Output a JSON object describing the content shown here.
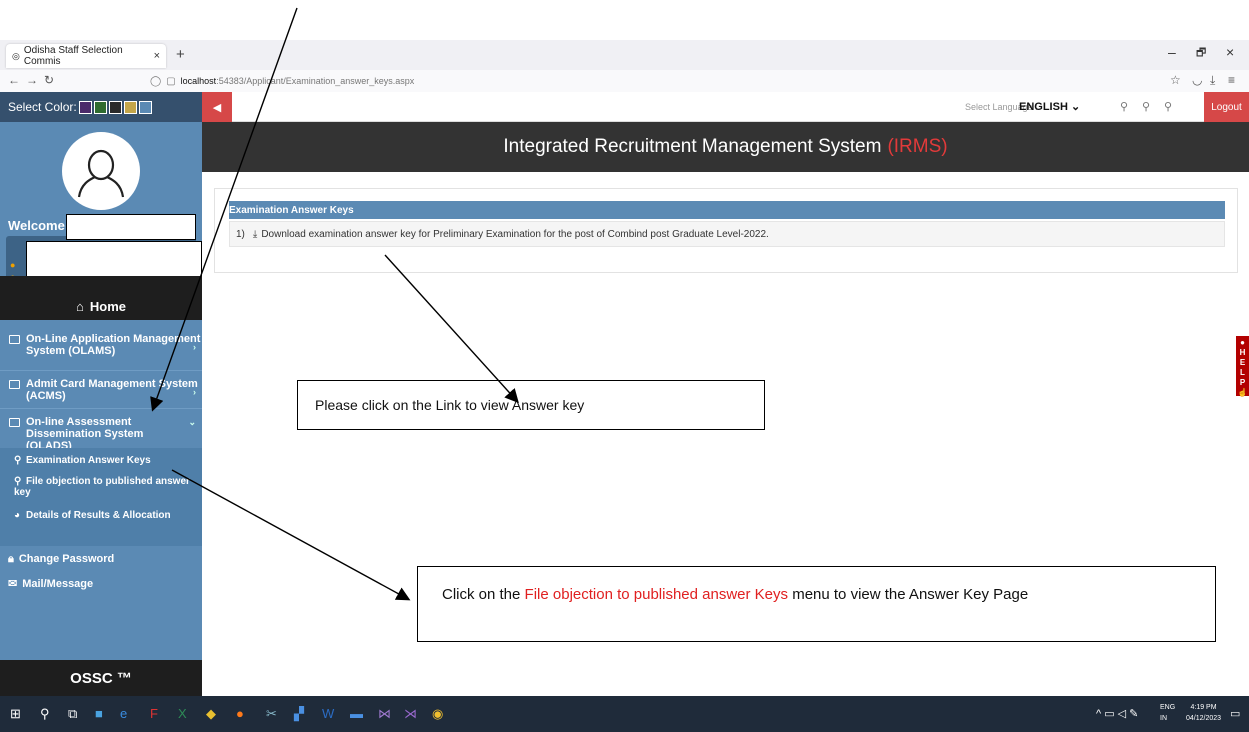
{
  "browser": {
    "tab_title": "Odisha Staff Selection Commis",
    "tab_close": "×",
    "new_tab": "+",
    "window_minimize": "–",
    "window_maximize": "🗗",
    "window_close": "×",
    "url_host": "localhost",
    "url_rest": ":54383/Applicant/Examination_answer_keys.aspx"
  },
  "sidebar": {
    "select_color_label": "Select Color:",
    "swatches": [
      "#4a2a6a",
      "#2f6b2f",
      "#2a2a2a",
      "#c4a64a",
      "#5b8ab4"
    ],
    "welcome": "Welcome",
    "home": "Home",
    "menu": [
      {
        "label": "On-Line Application Management System (OLAMS)"
      },
      {
        "label": "Admit Card Management System (ACMS)"
      },
      {
        "label": "On-line Assessment Dissemination System (OLADS)"
      }
    ],
    "submenu": [
      {
        "label": "Examination Answer Keys"
      },
      {
        "label": "File objection to published answer key"
      },
      {
        "label": "Details of Results & Allocation"
      }
    ],
    "change_password": "Change Password",
    "mail_message": "Mail/Message",
    "footer": "OSSC ™"
  },
  "toolbar": {
    "select_language_label": "Select Language :",
    "language": "ENGLISH",
    "logout": "Logout"
  },
  "banner": {
    "title": "Integrated Recruitment Management System",
    "acronym": "(IRMS)"
  },
  "content": {
    "card_title": "Examination Answer Keys",
    "row_number": "1)",
    "row_link": "Download examination answer key for Preliminary Examination for the post of Combind post Graduate Level-2022."
  },
  "help_tab": "HELP",
  "taskbar": {
    "lang1": "ENG",
    "lang2": "IN",
    "time": "4:19 PM",
    "date": "04/12/2023"
  },
  "callouts": {
    "link_hint": "Please click on the Link to view Answer key",
    "menu_hint_prefix": "Click on the",
    "menu_hint_highlight": "File objection to published answer Keys",
    "menu_hint_suffix": "menu to view the Answer Key Page"
  }
}
